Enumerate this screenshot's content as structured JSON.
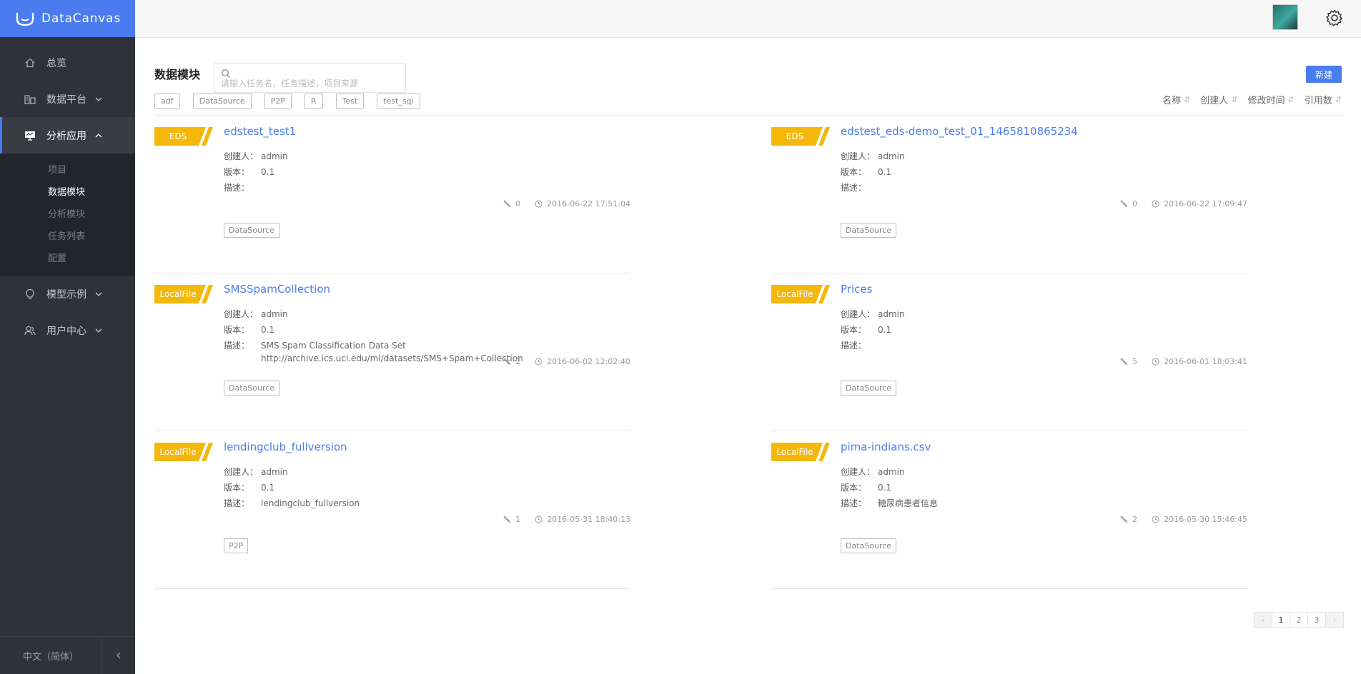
{
  "brand": {
    "name": "DataCanvas"
  },
  "nav": {
    "items": [
      {
        "label": "总览"
      },
      {
        "label": "数据平台"
      },
      {
        "label": "分析应用"
      },
      {
        "label": "模型示例"
      },
      {
        "label": "用户中心"
      }
    ],
    "subitems": [
      {
        "label": "项目"
      },
      {
        "label": "数据模块"
      },
      {
        "label": "分析模块"
      },
      {
        "label": "任务列表"
      },
      {
        "label": "配置"
      }
    ],
    "language": "中文（简体）"
  },
  "page": {
    "title": "数据模块",
    "search_placeholder": "请输入任务名，任务描述，项目来源",
    "new_button": "新建",
    "filter_tags": [
      "adf",
      "DataSource",
      "P2P",
      "R",
      "Test",
      "test_sql"
    ],
    "sorts": [
      "名称",
      "创建人",
      "修改时间",
      "引用数"
    ]
  },
  "labels": {
    "creator": "创建人：",
    "version": "版本：",
    "description": "描述："
  },
  "cards": [
    {
      "badge": "EDS",
      "name": "edstest_test1",
      "creator": "admin",
      "version": "0.1",
      "description": "",
      "description2": "",
      "refs": "0",
      "time": "2016-06-22 17:51:04",
      "tag": "DataSource"
    },
    {
      "badge": "EDS",
      "name": "edstest_eds-demo_test_01_1465810865234",
      "creator": "admin",
      "version": "0.1",
      "description": "",
      "description2": "",
      "refs": "0",
      "time": "2016-06-22 17:09:47",
      "tag": "DataSource"
    },
    {
      "badge": "LocalFile",
      "name": "SMSSpamCollection",
      "creator": "admin",
      "version": "0.1",
      "description": "SMS Spam Classification Data Set",
      "description2": "http://archive.ics.uci.edu/ml/datasets/SMS+Spam+Collection",
      "refs": "2",
      "time": "2016-06-02 12:02:40",
      "tag": "DataSource"
    },
    {
      "badge": "LocalFile",
      "name": "Prices",
      "creator": "admin",
      "version": "0.1",
      "description": "",
      "description2": "",
      "refs": "5",
      "time": "2016-06-01 18:03:41",
      "tag": "DataSource"
    },
    {
      "badge": "LocalFile",
      "name": "lendingclub_fullversion",
      "creator": "admin",
      "version": "0.1",
      "description": "lendingclub_fullversion",
      "description2": "",
      "refs": "1",
      "time": "2016-05-31 18:40:13",
      "tag": "P2P"
    },
    {
      "badge": "LocalFile",
      "name": "pima-indians.csv",
      "creator": "admin",
      "version": "0.1",
      "description": "糖尿病患者信息",
      "description2": "",
      "refs": "2",
      "time": "2016-05-30 15:46:45",
      "tag": "DataSource"
    }
  ],
  "pagination": {
    "pages": [
      "1",
      "2",
      "3"
    ],
    "current": "1"
  },
  "colors": {
    "accent": "#4a7cf0",
    "badge": "#f5b70a",
    "sidebar": "#2f323a"
  }
}
